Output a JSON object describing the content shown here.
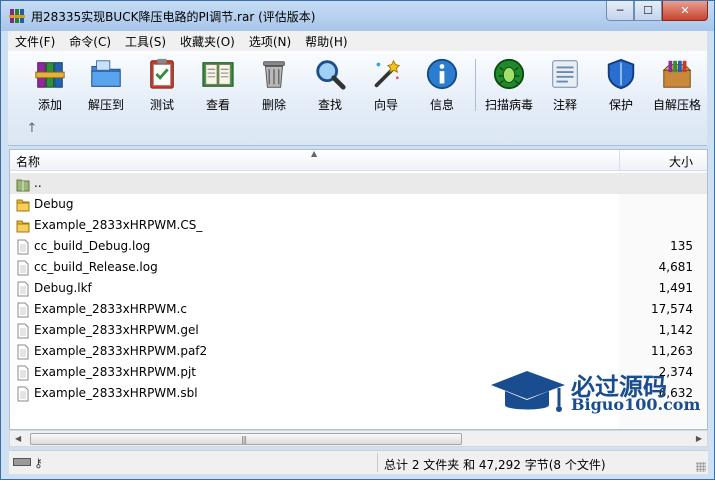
{
  "window": {
    "title": "用28335实现BUCK降压电路的PI调节.rar (评估版本)",
    "min_glyph": "─",
    "max_glyph": "☐",
    "close_glyph": "✕"
  },
  "menu": [
    "文件(F)",
    "命令(C)",
    "工具(S)",
    "收藏夹(O)",
    "选项(N)",
    "帮助(H)"
  ],
  "toolbar": {
    "buttons": [
      {
        "label": "添加",
        "icon": "books-add-icon"
      },
      {
        "label": "解压到",
        "icon": "folder-extract-icon"
      },
      {
        "label": "测试",
        "icon": "clipboard-test-icon"
      },
      {
        "label": "查看",
        "icon": "book-view-icon"
      },
      {
        "label": "删除",
        "icon": "trash-icon"
      },
      {
        "label": "查找",
        "icon": "magnifier-icon"
      },
      {
        "label": "向导",
        "icon": "wand-icon"
      },
      {
        "label": "信息",
        "icon": "info-icon"
      },
      {
        "label": "扫描病毒",
        "icon": "virus-scan-icon"
      },
      {
        "label": "注释",
        "icon": "comment-icon"
      },
      {
        "label": "保护",
        "icon": "shield-icon"
      },
      {
        "label": "自解压格",
        "icon": "sfx-box-icon"
      }
    ],
    "up_glyph": "↑"
  },
  "filelist": {
    "columns": {
      "name": "名称",
      "size": "大小"
    },
    "sort_glyph": "▲",
    "rows": [
      {
        "name": "..",
        "size": "",
        "type": "up"
      },
      {
        "name": "Debug",
        "size": "",
        "type": "folder"
      },
      {
        "name": "Example_2833xHRPWM.CS_",
        "size": "",
        "type": "folder"
      },
      {
        "name": "cc_build_Debug.log",
        "size": "135",
        "type": "file"
      },
      {
        "name": "cc_build_Release.log",
        "size": "4,681",
        "type": "file"
      },
      {
        "name": "Debug.lkf",
        "size": "1,491",
        "type": "file"
      },
      {
        "name": "Example_2833xHRPWM.c",
        "size": "17,574",
        "type": "file"
      },
      {
        "name": "Example_2833xHRPWM.gel",
        "size": "1,142",
        "type": "file"
      },
      {
        "name": "Example_2833xHRPWM.paf2",
        "size": "11,263",
        "type": "file"
      },
      {
        "name": "Example_2833xHRPWM.pjt",
        "size": "2,374",
        "type": "file"
      },
      {
        "name": "Example_2833xHRPWM.sbl",
        "size": "6,632",
        "type": "file"
      }
    ]
  },
  "scrollbar": {
    "left_glyph": "◀",
    "right_glyph": "▶",
    "grip_glyph": "|||"
  },
  "status": {
    "text": "总计 2 文件夹 和 47,292 字节(8 个文件)",
    "key_glyph": "⚷"
  },
  "watermark": {
    "brand": "必过源码",
    "url": "Biguo100.com"
  },
  "colors": {
    "accent": "#1a4d8f",
    "selection": "#eaeaea",
    "close": "#c7432c"
  }
}
